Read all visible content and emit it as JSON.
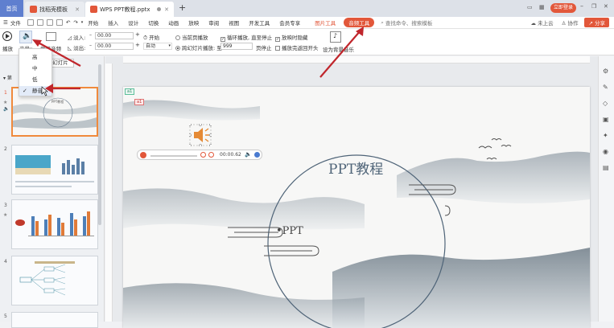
{
  "tabs": {
    "home": "首页",
    "template": "找稻壳模板",
    "doc": "WPS PPT教程.pptx"
  },
  "titlebar": {
    "login": "立即登录"
  },
  "menu": {
    "file": "文件",
    "items": [
      "开始",
      "插入",
      "设计",
      "切换",
      "动画",
      "放映",
      "审阅",
      "视图",
      "开发工具",
      "会员专享"
    ],
    "picture_tools": "图片工具",
    "audio_tools": "音频工具",
    "search": "查找命令、搜索模板",
    "cloud": "未上云",
    "collab": "协作",
    "share": "分享"
  },
  "ribbon": {
    "play": "播放",
    "volume": "音量",
    "trim": "裁剪音频",
    "fade_in_label": "淡入:",
    "fade_in": "00.00",
    "fade_out_label": "淡出:",
    "fade_out": "00.00",
    "start_label": "开始",
    "start_value": "自动",
    "current_slide": "当前页播放",
    "cross_slide": "跨幻灯片播放: 至",
    "cross_value": "999",
    "page_stop": "页停止",
    "loop": "循环播放, 直至停止",
    "hide": "放映时隐藏",
    "rewind": "播放完返回开头",
    "set_bg_music": "设为背景音乐"
  },
  "volume_menu": {
    "items": [
      "高",
      "中",
      "低",
      "静音"
    ],
    "selected": "静音"
  },
  "left_panel": {
    "heading": "幻灯片",
    "group_prefix": "第"
  },
  "slides": [
    {
      "num": "1",
      "title": "PPT教程"
    },
    {
      "num": "2"
    },
    {
      "num": "3"
    },
    {
      "num": "4"
    },
    {
      "num": "5"
    }
  ],
  "slide": {
    "title": "PPT教程",
    "subtitle": "•PPT",
    "badge_a1": "a1",
    "badge_a2": "a1",
    "audio_time": "00:00.62"
  },
  "colors": {
    "accent": "#e2573a",
    "home_tab": "#5f7fcf",
    "selection": "#f08a3c",
    "audio_icon": "#e58a35",
    "arrow": "#c0262c"
  }
}
